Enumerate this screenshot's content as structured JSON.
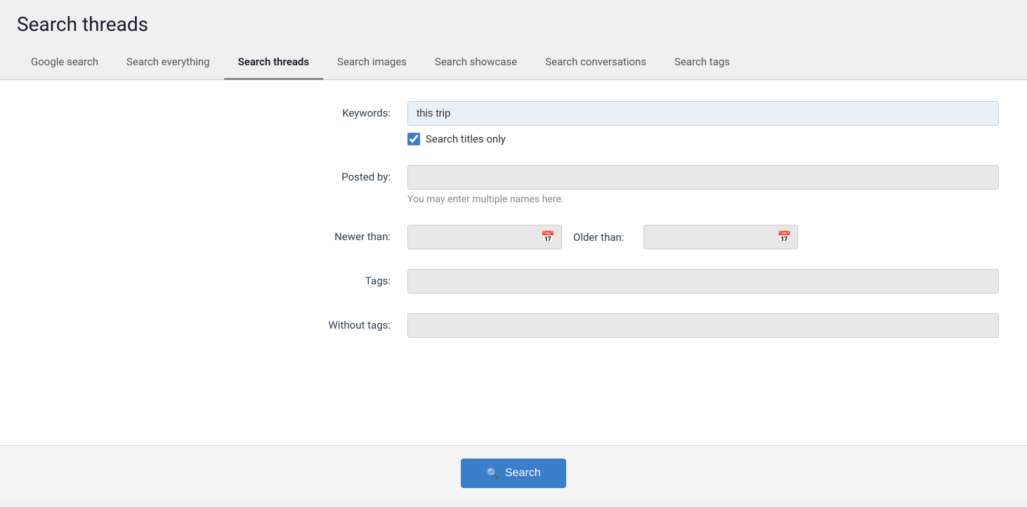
{
  "page": {
    "title": "Search threads"
  },
  "tabs": [
    {
      "id": "google-search",
      "label": "Google search",
      "active": false
    },
    {
      "id": "search-everything",
      "label": "Search everything",
      "active": false
    },
    {
      "id": "search-threads",
      "label": "Search threads",
      "active": true
    },
    {
      "id": "search-images",
      "label": "Search images",
      "active": false
    },
    {
      "id": "search-showcase",
      "label": "Search showcase",
      "active": false
    },
    {
      "id": "search-conversations",
      "label": "Search conversations",
      "active": false
    },
    {
      "id": "search-tags",
      "label": "Search tags",
      "active": false
    }
  ],
  "form": {
    "keywords_label": "Keywords:",
    "keywords_value": "this trip",
    "search_titles_only_label": "Search titles only",
    "search_titles_only_checked": true,
    "posted_by_label": "Posted by:",
    "posted_by_value": "",
    "posted_by_helper": "You may enter multiple names here.",
    "newer_than_label": "Newer than:",
    "newer_than_value": "",
    "older_than_label": "Older than:",
    "older_than_value": "",
    "tags_label": "Tags:",
    "tags_value": "",
    "without_tags_label": "Without tags:",
    "without_tags_value": ""
  },
  "footer": {
    "search_button_label": "Search",
    "search_icon": "🔍"
  }
}
